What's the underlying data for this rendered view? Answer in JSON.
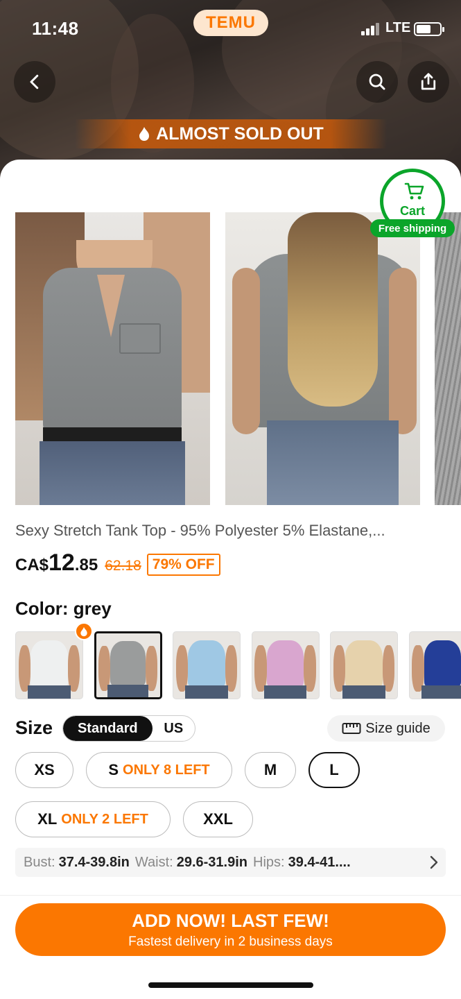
{
  "status_bar": {
    "time": "11:48",
    "app_badge": "TEMU",
    "network": "LTE"
  },
  "header": {
    "back_icon": "chevron-left-icon",
    "search_icon": "search-icon",
    "share_icon": "share-icon",
    "banner_text": "ALMOST SOLD OUT",
    "banner_icon": "flame-icon"
  },
  "cart": {
    "label": "Cart",
    "free_shipping": "Free shipping",
    "accent": "#0ba52a"
  },
  "product": {
    "title": "Sexy Stretch Tank Top - 95% Polyester 5% Elastane,...",
    "currency": "CA$",
    "price_main": "12",
    "price_cents": ".85",
    "original_price": "62.18",
    "discount": "79% OFF"
  },
  "color": {
    "label": "Color: grey",
    "swatches": [
      {
        "name": "white",
        "hex": "#eef0f0"
      },
      {
        "name": "grey",
        "hex": "#9a9c9c",
        "selected": true
      },
      {
        "name": "light-blue",
        "hex": "#9fc8e4"
      },
      {
        "name": "pink",
        "hex": "#d9a6cf"
      },
      {
        "name": "beige",
        "hex": "#e6d2ac"
      },
      {
        "name": "navy",
        "hex": "#243e98"
      }
    ]
  },
  "size": {
    "label": "Size",
    "toggle": [
      "Standard",
      "US"
    ],
    "guide": "Size guide",
    "options": [
      {
        "label": "XS"
      },
      {
        "label": "S",
        "note": "ONLY 8 LEFT"
      },
      {
        "label": "M"
      },
      {
        "label": "L",
        "selected": true
      },
      {
        "label": "XL",
        "note": "ONLY 2 LEFT"
      },
      {
        "label": "XXL"
      }
    ],
    "measure": {
      "bust_k": "Bust:",
      "bust_v": "37.4-39.8in",
      "waist_k": "Waist:",
      "waist_v": "29.6-31.9in",
      "hips_k": "Hips:",
      "hips_v": "39.4-41...."
    }
  },
  "cta": {
    "line1": "ADD NOW! LAST FEW!",
    "line2": "Fastest delivery in 2 business days",
    "color": "#fb7701"
  }
}
